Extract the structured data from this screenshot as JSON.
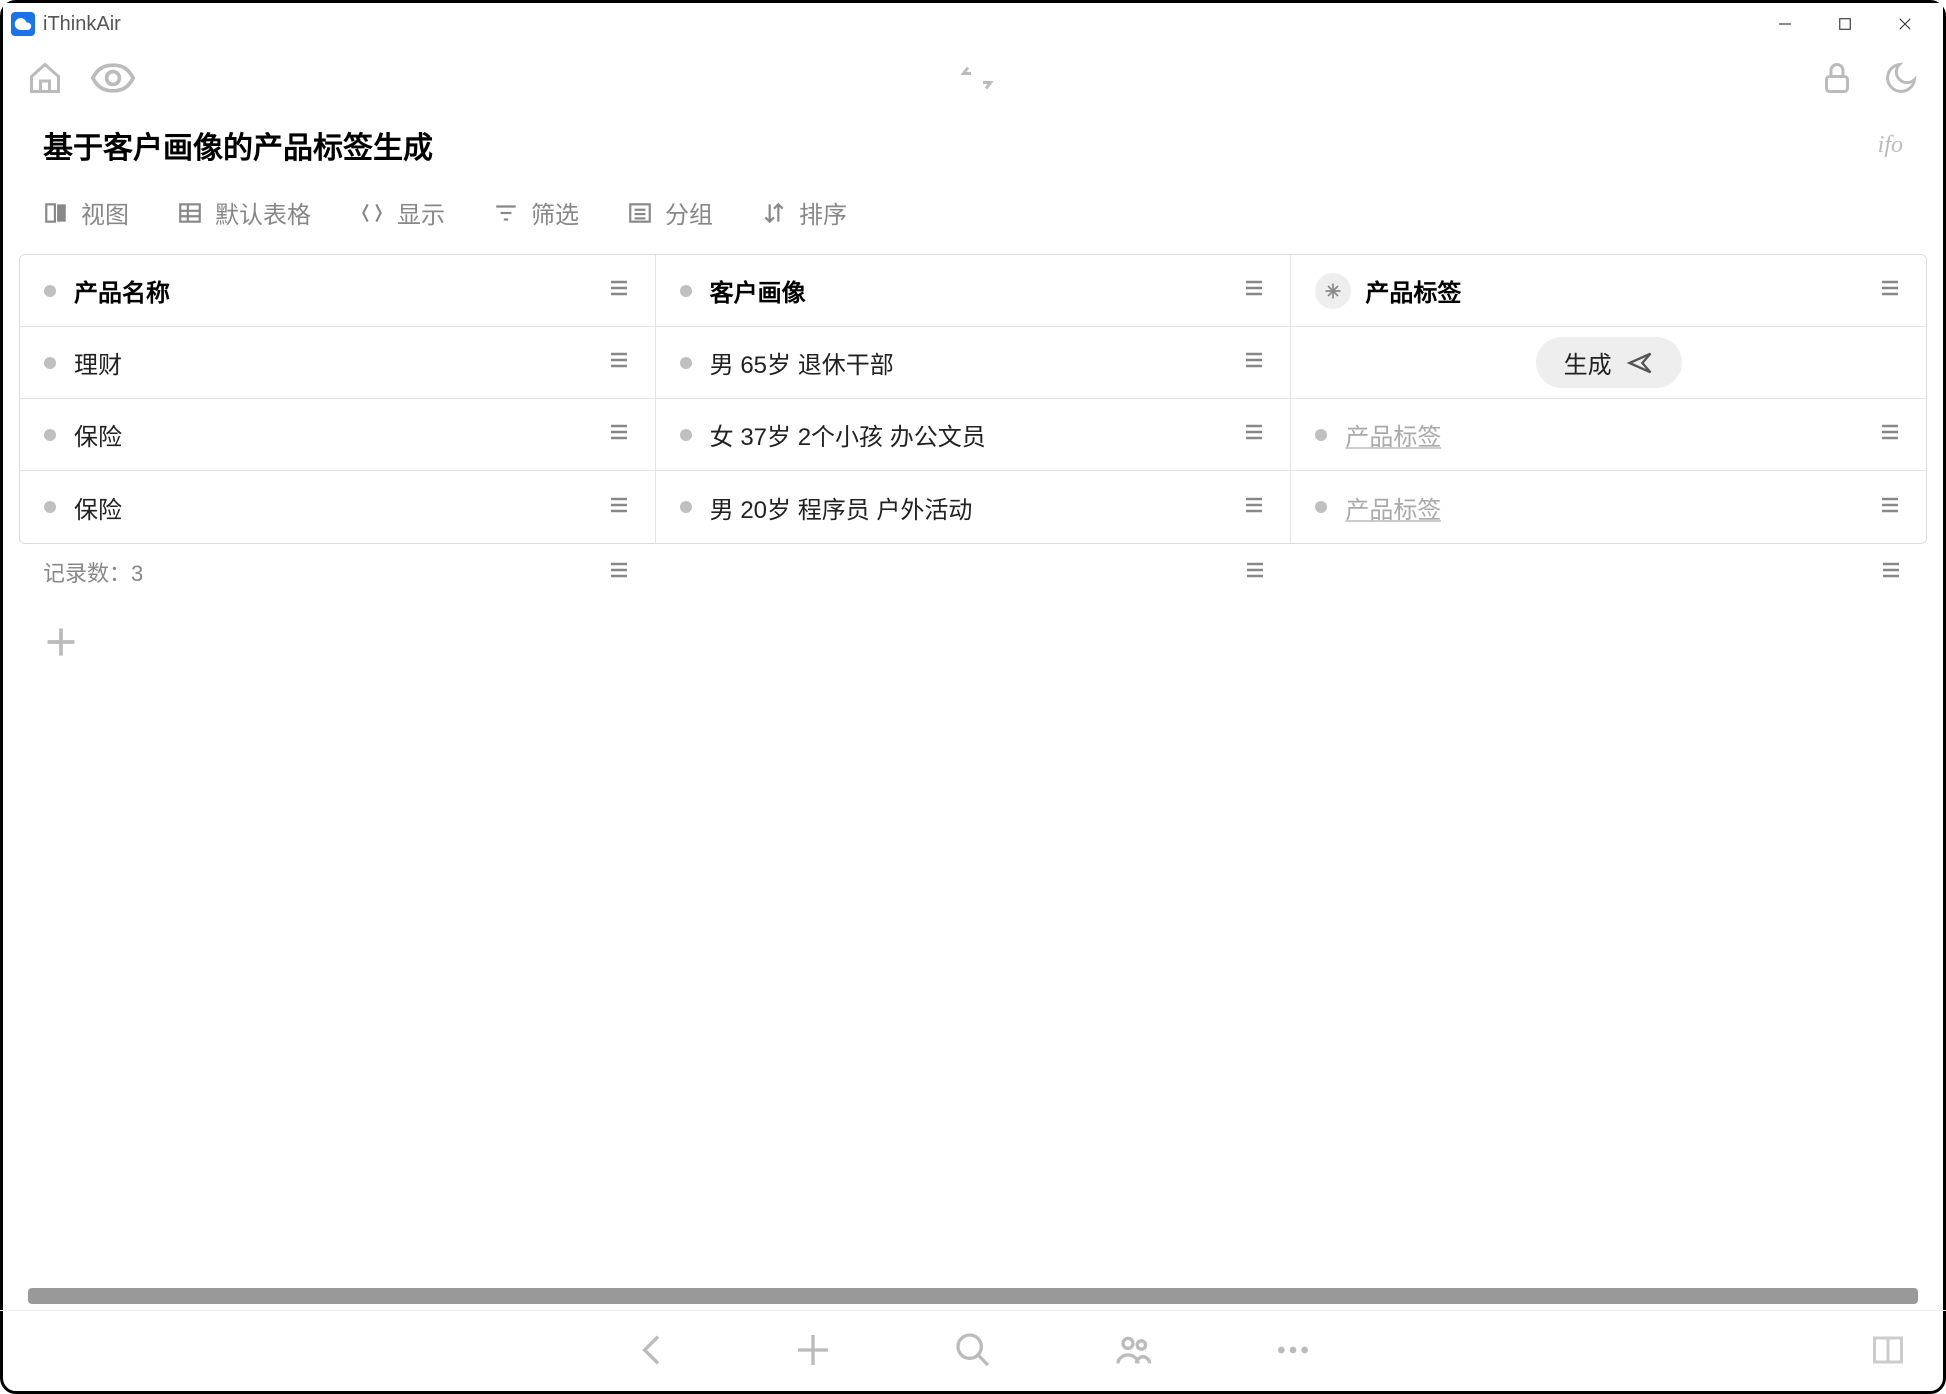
{
  "app": {
    "title": "iThinkAir"
  },
  "page": {
    "title": "基于客户画像的产品标签生成",
    "ifo": "ifo"
  },
  "view_toolbar": {
    "view": "视图",
    "default_table": "默认表格",
    "display": "显示",
    "filter": "筛选",
    "group": "分组",
    "sort": "排序"
  },
  "table": {
    "columns": [
      "产品名称",
      "客户画像",
      "产品标签"
    ],
    "rows": [
      {
        "product": "理财",
        "profile": "男 65岁 退休干部",
        "tag_generate": "生成",
        "tag_placeholder": ""
      },
      {
        "product": "保险",
        "profile": "女 37岁 2个小孩 办公文员",
        "tag_generate": "",
        "tag_placeholder": "产品标签"
      },
      {
        "product": "保险",
        "profile": "男 20岁 程序员 户外活动",
        "tag_generate": "",
        "tag_placeholder": "产品标签"
      }
    ],
    "record_label": "记录数：",
    "record_count": "3"
  }
}
